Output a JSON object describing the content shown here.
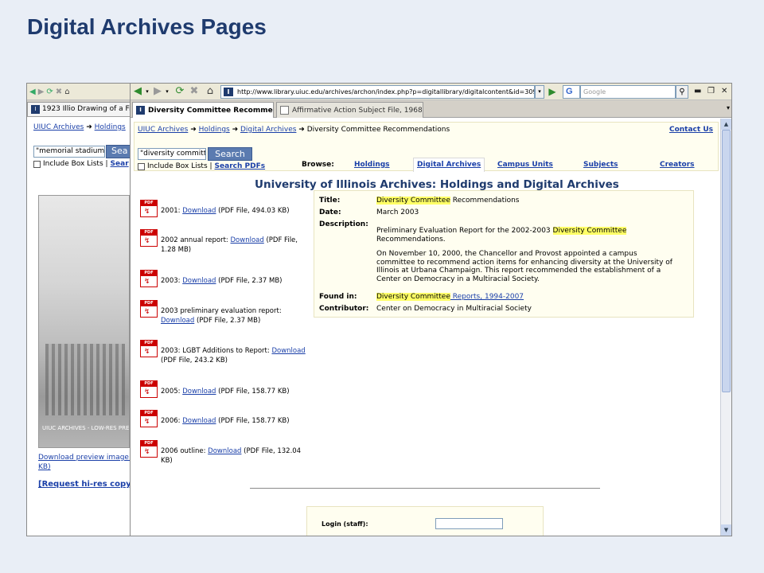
{
  "slide": {
    "title": "Digital Archives Pages"
  },
  "browser": {
    "url": "http://www.library.uiuc.edu/archives/archon/index.php?p=digitallibrary/digitalcontent&id=3097&q=%",
    "google_placeholder": "Google",
    "google_label": "G",
    "tabs": [
      {
        "label": "1923 Illio Drawing of a Fir"
      },
      {
        "label": "Diversity Committee Recommen..."
      },
      {
        "label": "Affirmative Action Subject File, 1968-..."
      }
    ]
  },
  "back_page": {
    "crumb_home": "UIUC Archives",
    "crumb_holdings": "Holdings",
    "search_value": "\"memorial stadium\"",
    "search_button": "Sea",
    "include_label": "Include Box Lists |",
    "search_pdfs": "Sear",
    "image_caption": "UIUC ARCHIVES - LOW-RES PRE",
    "download_preview": "Download preview image (",
    "download_preview_size": "KB)",
    "request_hires": "[Request hi-res copy"
  },
  "page": {
    "breadcrumb": {
      "home": "UIUC Archives",
      "holdings": "Holdings",
      "digital": "Digital Archives",
      "current": "Diversity Committee Recommendations"
    },
    "contact": "Contact Us",
    "search_value": "\"diversity committee\"",
    "search_button": "Search",
    "include_label": "Include Box Lists |",
    "search_pdfs": "Search PDFs",
    "browse_label": "Browse:",
    "nav": [
      "Holdings",
      "Digital Archives",
      "Campus Units",
      "Subjects",
      "Creators"
    ],
    "title": "University of Illinois Archives: Holdings and Digital Archives",
    "pdf_icon_label": "PDF",
    "downloads": [
      {
        "prefix": "2001: ",
        "link": "Download",
        "suffix": " (PDF File, 494.03 KB)"
      },
      {
        "prefix": "2002 annual report: ",
        "link": "Download",
        "suffix": " (PDF File, 1.28 MB)"
      },
      {
        "prefix": "2003: ",
        "link": "Download",
        "suffix": " (PDF File, 2.37 MB)"
      },
      {
        "prefix": "2003 preliminary evaluation report: ",
        "link": "Download",
        "suffix": " (PDF File, 2.37 MB)"
      },
      {
        "prefix": "2003: LGBT Additions to Report: ",
        "link": "Download",
        "suffix": " (PDF File, 243.2 KB)"
      },
      {
        "prefix": "2005: ",
        "link": "Download",
        "suffix": " (PDF File, 158.77 KB)"
      },
      {
        "prefix": "2006: ",
        "link": "Download",
        "suffix": " (PDF File, 158.77 KB)"
      },
      {
        "prefix": "2006 outline: ",
        "link": "Download",
        "suffix": " (PDF File, 132.04 KB)"
      }
    ],
    "details": {
      "title_label": "Title:",
      "title_hl": "Diversity Committee",
      "title_rest": " Recommendations",
      "date_label": "Date:",
      "date": "March 2003",
      "desc_label": "Description:",
      "desc1_pre": "Preliminary Evaluation Report for the 2002-2003 ",
      "desc1_hl": "Diversity Committee",
      "desc1_post": " Recommendations.",
      "desc2": "On November 10, 2000, the Chancellor and Provost appointed a campus committee to recommend action items for enhancing diversity at the University of Illinois at Urbana Champaign. This report recommended the establishment of a Center on Democracy in a Multiracial Society.",
      "found_label": "Found in:",
      "found_hl": "Diversity Committee",
      "found_rest": " Reports, 1994-2007",
      "contrib_label": "Contributor:",
      "contributor": "Center on Democracy in Multiracial Society"
    },
    "login_label": "Login (staff):"
  }
}
